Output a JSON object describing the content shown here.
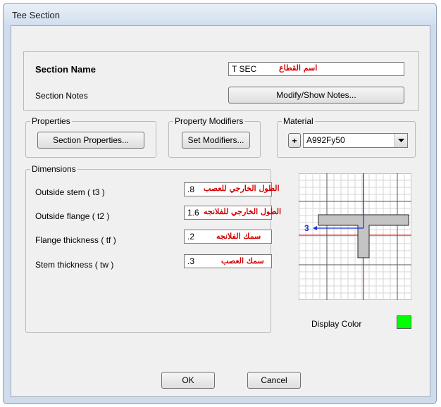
{
  "window": {
    "title": "Tee Section"
  },
  "section": {
    "name_label": "Section Name",
    "name_value": "T SEC",
    "name_annotation": "اسم القطاع",
    "notes_label": "Section Notes",
    "notes_button": "Modify/Show Notes..."
  },
  "properties": {
    "legend": "Properties",
    "button": "Section Properties..."
  },
  "modifiers": {
    "legend": "Property Modifiers",
    "button": "Set Modifiers..."
  },
  "material": {
    "legend": "Material",
    "add_button": "+",
    "selected": "A992Fy50"
  },
  "dimensions": {
    "legend": "Dimensions",
    "rows": [
      {
        "label": "Outside stem  ( t3 )",
        "value": ".8",
        "annotation": "الطول الخارجي للعصب"
      },
      {
        "label": "Outside flange  ( t2 )",
        "value": "1.6",
        "annotation": "الطول الخارجي للفلانجه"
      },
      {
        "label": "Flange thickness  ( tf )",
        "value": ".2",
        "annotation": "سمك الفلانجه"
      },
      {
        "label": "Stem thickness  ( tw )",
        "value": ".3",
        "annotation": "سمك العصب"
      }
    ]
  },
  "diagram": {
    "axis_label": "3"
  },
  "display_color": {
    "label": "Display Color",
    "color": "#00ff00"
  },
  "buttons": {
    "ok": "OK",
    "cancel": "Cancel"
  }
}
